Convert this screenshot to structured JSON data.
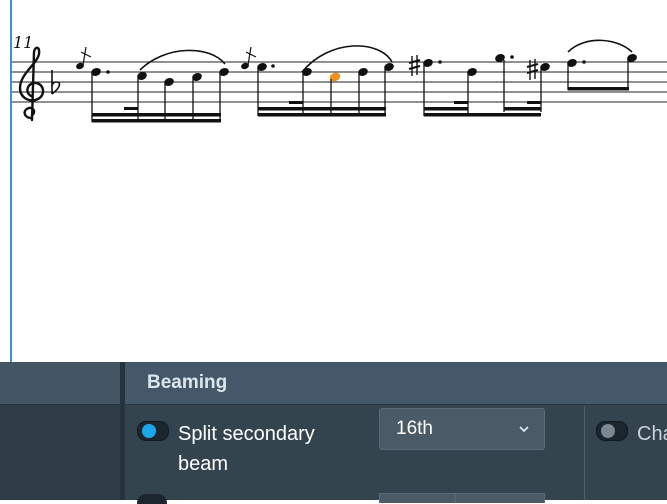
{
  "score": {
    "bar_number": "11",
    "highlight_color": "#f0901e",
    "accent_color": "#3d8fd6"
  },
  "panel": {
    "section_title": "Beaming",
    "split_secondary_beam": {
      "label": "Split secondary beam",
      "enabled": true,
      "toggle_color": "#1aa7ea"
    },
    "beam_duration_select": {
      "value": "16th",
      "icon": "chevron-down-icon"
    },
    "second_option": {
      "label": "Cha",
      "enabled": false
    }
  }
}
